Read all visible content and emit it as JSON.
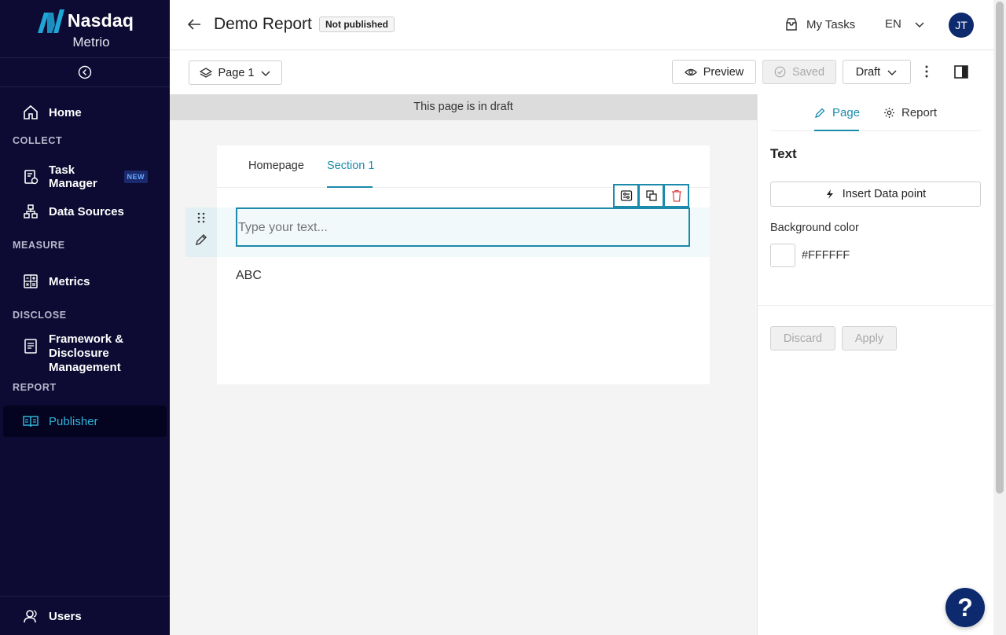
{
  "brand": {
    "name": "Nasdaq",
    "product": "Metrio"
  },
  "sidebar": {
    "home": "Home",
    "sections": {
      "collect": "COLLECT",
      "measure": "MEASURE",
      "disclose": "DISCLOSE",
      "report": "REPORT"
    },
    "task_manager": "Task Manager",
    "task_manager_badge": "NEW",
    "data_sources": "Data Sources",
    "metrics": "Metrics",
    "framework_line1": "Framework &",
    "framework_line2": "Disclosure",
    "framework_line3": "Management",
    "publisher": "Publisher",
    "users": "Users"
  },
  "header": {
    "title": "Demo Report",
    "status_badge": "Not published",
    "my_tasks": "My Tasks",
    "language": "EN",
    "avatar_initials": "JT"
  },
  "toolbar": {
    "page_select": "Page 1",
    "preview": "Preview",
    "saved": "Saved",
    "status_select": "Draft"
  },
  "canvas": {
    "draft_notice": "This page is in draft",
    "tabs": [
      "Homepage",
      "Section 1"
    ],
    "text_placeholder": "Type your text...",
    "text_block_content": "ABC"
  },
  "panel": {
    "tab_page": "Page",
    "tab_report": "Report",
    "section_title": "Text",
    "insert_data_point": "Insert Data point",
    "bg_color_label": "Background color",
    "bg_color_value": "#FFFFFF",
    "discard": "Discard",
    "apply": "Apply"
  },
  "colors": {
    "sidebar_bg": "#0d0b33",
    "accent": "#1b8aab",
    "avatar_bg": "#0d2a6e",
    "delete_red": "#e04848"
  }
}
